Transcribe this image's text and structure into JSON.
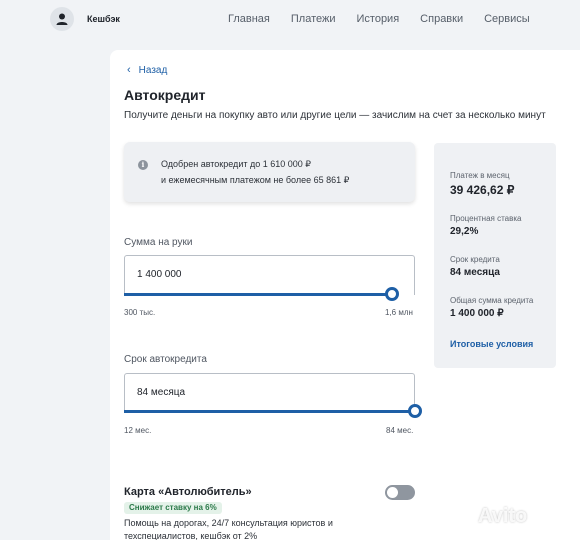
{
  "header": {
    "cashback": "Кешбэк",
    "nav": [
      "Главная",
      "Платежи",
      "История",
      "Справки",
      "Сервисы"
    ]
  },
  "page": {
    "back": "Назад",
    "title": "Автокредит",
    "subtitle": "Получите деньги на покупку авто или другие цели — зачислим на счет за несколько минут"
  },
  "approval": {
    "line1": "Одобрен автокредит до 1 610 000 ₽",
    "line2": "и ежемесячным платежом не более 65 861 ₽"
  },
  "amount": {
    "label": "Сумма на руки",
    "value": "1 400 000",
    "min_label": "300 тыс.",
    "max_label": "1,6 млн",
    "fraction": 0.92
  },
  "term": {
    "label": "Срок автокредита",
    "value": "84 месяца",
    "min_label": "12 мес.",
    "max_label": "84 мес.",
    "fraction": 1.0
  },
  "summary": {
    "payment_label": "Платеж в месяц",
    "payment_value": "39 426,62 ₽",
    "rate_label": "Процентная ставка",
    "rate_value": "29,2%",
    "term_label": "Срок кредита",
    "term_value": "84 месяца",
    "total_label": "Общая сумма кредита",
    "total_value": "1 400 000 ₽",
    "link": "Итоговые условия"
  },
  "offer": {
    "title": "Карта «Автолюбитель»",
    "badge": "Снижает ставку на 6%",
    "desc": "Помощь на дорогах, 24/7 консультация юристов и техспециалистов, кешбэк от 2%",
    "enabled": false
  },
  "watermark": "Avito",
  "colors": {
    "accent": "#1e5fa6",
    "badge_bg": "#e4f2e9",
    "badge_text": "#2c7a4a"
  }
}
